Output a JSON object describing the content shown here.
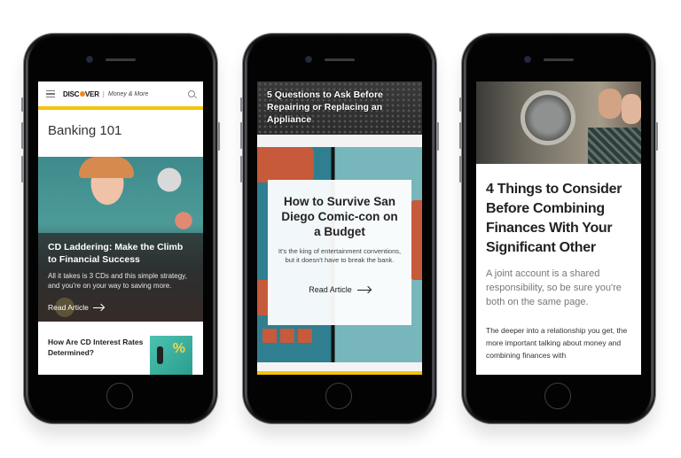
{
  "phones": [
    {
      "header": {
        "brand": "DISCOVER",
        "separator": "|",
        "section": "Money & More",
        "menu_icon": "hamburger-icon",
        "search_icon": "search-icon"
      },
      "page_title": "Banking 101",
      "featured": {
        "title": "CD Laddering: Make the Climb to Financial Success",
        "summary": "All it takes is 3 CDs and this simple strategy, and you're on your way to saving more.",
        "link_label": "Read Article",
        "link_icon": "arrow-right-icon"
      },
      "list_card": {
        "title": "How Are CD Interest Rates Determined?",
        "thumb_label": "%"
      }
    },
    {
      "top_article": {
        "title": "5 Questions to Ask Before Repairing or Replacing an Appliance"
      },
      "featured": {
        "title": "How to Survive San Diego Comic-con on a Budget",
        "summary": "It's the king of entertainment conventions, but it doesn't have to break the bank.",
        "link_label": "Read Article",
        "link_icon": "arrow-right-icon"
      }
    },
    {
      "article": {
        "title": "4 Things to Consider Before Combining Finances With Your Significant Other",
        "lead": "A joint account is a shared responsibility, so be sure you're both on the same page.",
        "body": "The deeper into a relationship you get, the more important talking about money and combining finances with"
      }
    }
  ],
  "colors": {
    "accent_yellow": "#f5c400",
    "brand_orange": "#f08a1c"
  }
}
